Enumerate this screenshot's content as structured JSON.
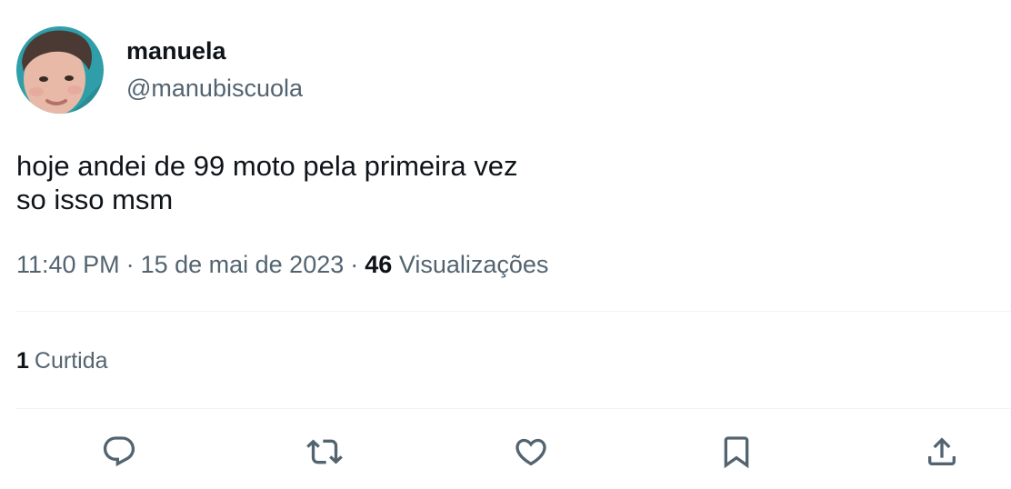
{
  "author": {
    "display_name": "manuela",
    "handle": "@manubiscuola"
  },
  "tweet": {
    "lines": [
      "hoje andei de 99 moto pela primeira vez",
      "so isso msm"
    ]
  },
  "meta": {
    "time": "11:40 PM",
    "separator": "·",
    "date": "15 de mai de 2023",
    "views_count": "46",
    "views_label": "Visualizações"
  },
  "stats": {
    "likes_count": "1",
    "likes_label": "Curtida"
  },
  "actions": [
    {
      "icon": "reply-icon"
    },
    {
      "icon": "retweet-icon"
    },
    {
      "icon": "like-icon"
    },
    {
      "icon": "bookmark-icon"
    },
    {
      "icon": "share-icon"
    }
  ],
  "colors": {
    "text_primary": "#0f1419",
    "text_secondary": "#536471",
    "divider": "#eff3f4",
    "avatar_background": "#2f9ea8"
  }
}
